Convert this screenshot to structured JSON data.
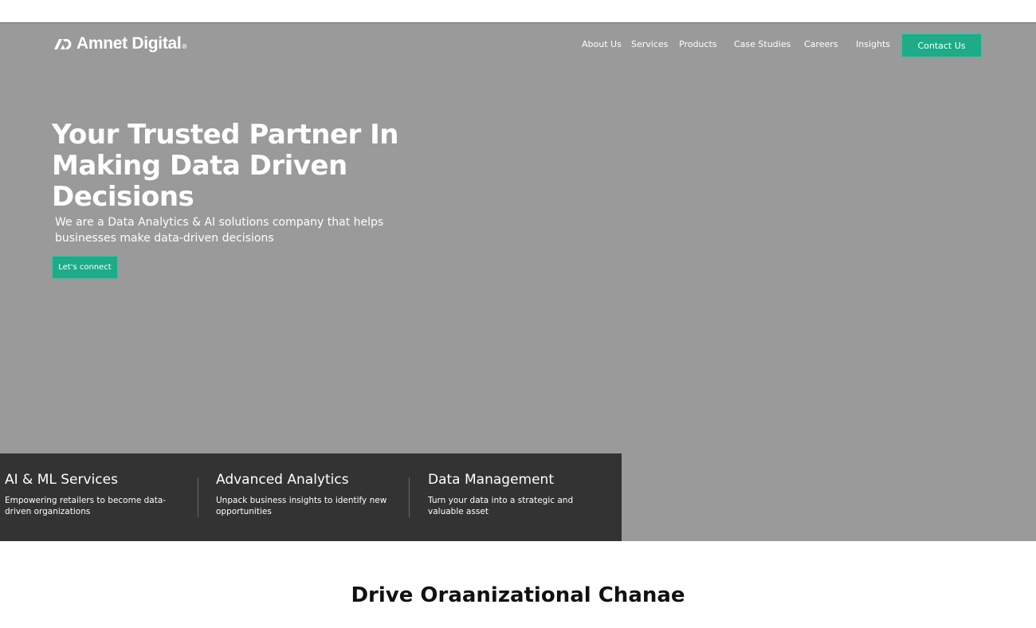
{
  "brand": {
    "name": "Amnet Digital",
    "registered": "®",
    "logo_icon": "amnet-ad-logo-icon"
  },
  "nav": {
    "items": [
      {
        "label": "About Us"
      },
      {
        "label": "Services"
      },
      {
        "label": "Products"
      },
      {
        "label": "Case Studies"
      },
      {
        "label": "Careers"
      },
      {
        "label": "Insights"
      }
    ],
    "contact_label": "Contact Us"
  },
  "hero": {
    "headline": "Your Trusted Partner In Making Data Driven Decisions",
    "subtitle": "We are a Data Analytics & AI solutions company that helps businesses make data-driven decisions",
    "cta_label": "Let's connect"
  },
  "services": [
    {
      "title": "AI & ML Services",
      "description": "Empowering retailers to become data-driven organizations"
    },
    {
      "title": "Advanced Analytics",
      "description": "Unpack business insights to identify new opportunities"
    },
    {
      "title": "Data Management",
      "description": "Turn your data into a strategic and valuable asset"
    }
  ],
  "section": {
    "title": "Drive Oraanizational Chanae"
  },
  "colors": {
    "hero_bg": "#9a9a9a",
    "accent": "#1dab88",
    "services_bg": "#333333",
    "text_light": "#ffffff",
    "text_dark": "#111111"
  }
}
